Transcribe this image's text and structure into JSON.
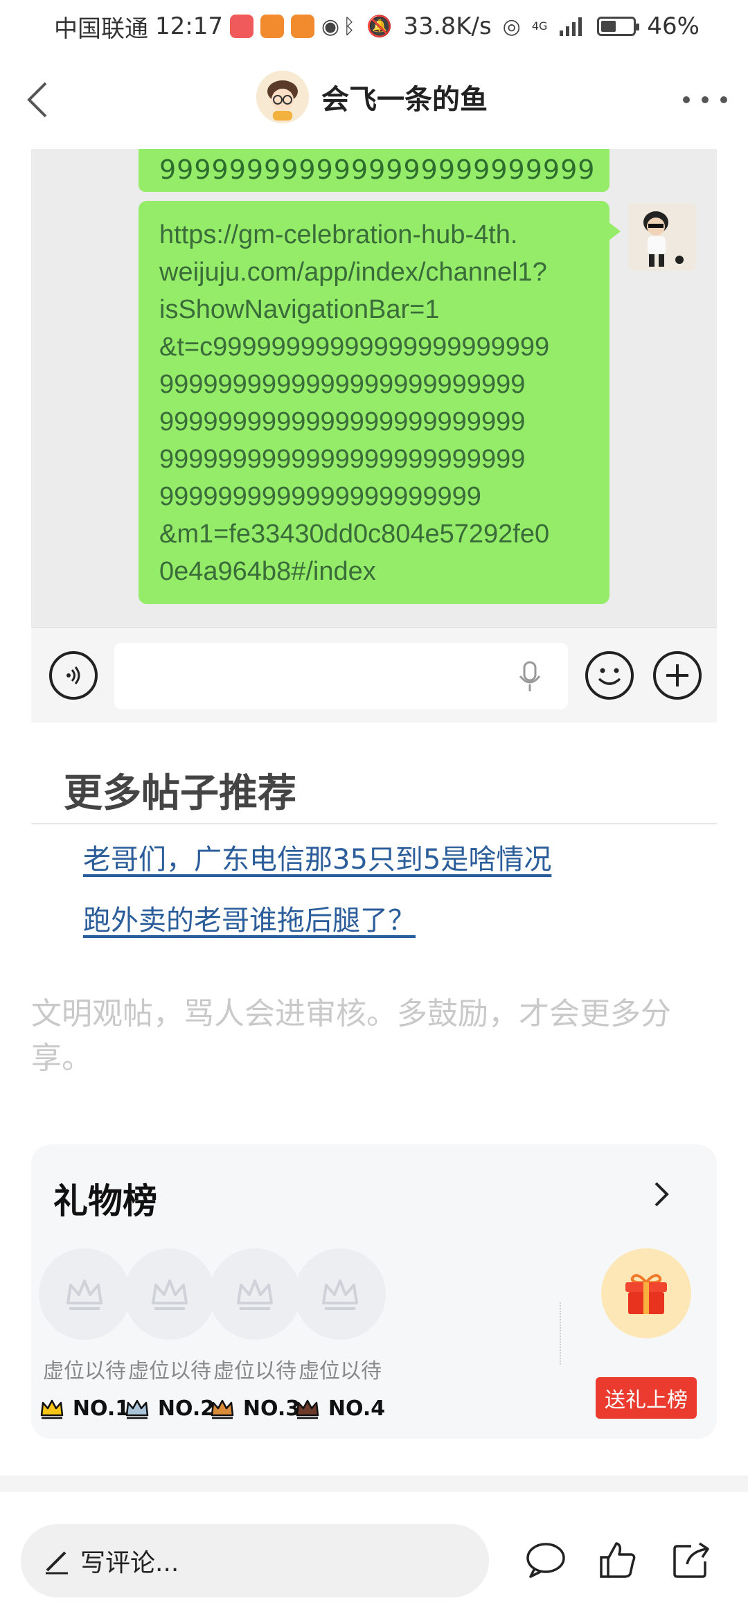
{
  "status_bar": {
    "carrier": "中国联通",
    "time": "12:17",
    "speed": "33.8K/s",
    "network": "4G",
    "battery": "46%",
    "battery_level": 0.46
  },
  "header": {
    "title": "会飞一条的鱼"
  },
  "chat": {
    "top_bubble_tail": "9999999999999999999999999",
    "url_message": "https://gm-celebration-hub-4th.\nweijuju.com/app/index/channel1?\nisShowNavigationBar=1\n&t=c99999999999999999999999\n9999999999999999999999999\n9999999999999999999999999\n9999999999999999999999999\n9999999999999999999999\n&m1=fe33430dd0c804e57292fe0\n0e4a964b8#/index"
  },
  "recommendations": {
    "title": "更多帖子推荐",
    "links": [
      "老哥们，广东电信那35只到5是啥情况",
      "跑外卖的老哥谁拖后腿了？"
    ]
  },
  "notice": "文明观帖，骂人会进审核。多鼓励，才会更多分享。",
  "gift_board": {
    "title": "礼物榜",
    "slots": [
      {
        "wait": "虚位以待",
        "rank": "NO.1",
        "crown_color": "#f5c518"
      },
      {
        "wait": "虚位以待",
        "rank": "NO.2",
        "crown_color": "#a9c4d8"
      },
      {
        "wait": "虚位以待",
        "rank": "NO.3",
        "crown_color": "#d98b3a"
      },
      {
        "wait": "虚位以待",
        "rank": "NO.4",
        "crown_color": "#6b3a2a"
      }
    ],
    "send_button": "送礼上榜"
  },
  "bottom_bar": {
    "comment_placeholder": "写评论..."
  },
  "colors": {
    "bubble": "#95ec69",
    "link": "#2a5d9a",
    "send_button": "#ea3b2e"
  },
  "icons": [
    "back-arrow-icon",
    "more-icon",
    "voice-icon",
    "mic-icon",
    "emoji-icon",
    "plus-icon",
    "chevron-right-icon",
    "crown-icon",
    "gift-icon",
    "pencil-icon",
    "comment-icon",
    "like-icon",
    "share-icon"
  ]
}
